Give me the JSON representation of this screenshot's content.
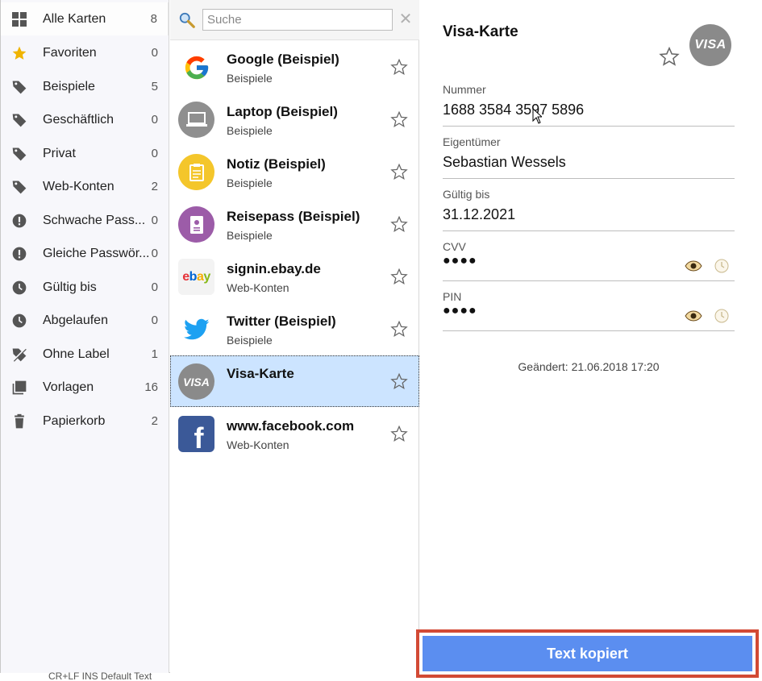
{
  "sidebar": {
    "items": [
      {
        "label": "Alle Karten",
        "count": "8",
        "icon": "grid-icon"
      },
      {
        "label": "Favoriten",
        "count": "0",
        "icon": "star-filled-icon"
      },
      {
        "label": "Beispiele",
        "count": "5",
        "icon": "tag-icon"
      },
      {
        "label": "Geschäftlich",
        "count": "0",
        "icon": "tag-icon"
      },
      {
        "label": "Privat",
        "count": "0",
        "icon": "tag-icon"
      },
      {
        "label": "Web-Konten",
        "count": "2",
        "icon": "tag-icon"
      },
      {
        "label": "Schwache Pass...",
        "count": "0",
        "icon": "warning-icon"
      },
      {
        "label": "Gleiche Passwör...",
        "count": "0",
        "icon": "warning-icon"
      },
      {
        "label": "Gültig bis",
        "count": "0",
        "icon": "clock-icon"
      },
      {
        "label": "Abgelaufen",
        "count": "0",
        "icon": "clock-icon"
      },
      {
        "label": "Ohne Label",
        "count": "1",
        "icon": "no-tag-icon"
      },
      {
        "label": "Vorlagen",
        "count": "16",
        "icon": "templates-icon"
      },
      {
        "label": "Papierkorb",
        "count": "2",
        "icon": "trash-icon"
      }
    ]
  },
  "search": {
    "placeholder": "Suche",
    "value": ""
  },
  "entries": [
    {
      "title": "Google (Beispiel)",
      "subtitle": "Beispiele",
      "icon": "google-icon"
    },
    {
      "title": "Laptop (Beispiel)",
      "subtitle": "Beispiele",
      "icon": "laptop-icon"
    },
    {
      "title": "Notiz (Beispiel)",
      "subtitle": "Beispiele",
      "icon": "note-icon"
    },
    {
      "title": "Reisepass (Beispiel)",
      "subtitle": "Beispiele",
      "icon": "passport-icon"
    },
    {
      "title": "signin.ebay.de",
      "subtitle": "Web-Konten",
      "icon": "ebay-icon",
      "logo_text": "ebay"
    },
    {
      "title": "Twitter (Beispiel)",
      "subtitle": "Beispiele",
      "icon": "twitter-icon"
    },
    {
      "title": "Visa-Karte",
      "subtitle": "",
      "icon": "visa-icon",
      "logo_text": "VISA"
    },
    {
      "title": "www.facebook.com",
      "subtitle": "Web-Konten",
      "icon": "facebook-icon",
      "logo_text": "f"
    }
  ],
  "detail": {
    "title": "Visa-Karte",
    "logo_text": "VISA",
    "fields": [
      {
        "label": "Nummer",
        "value": "1688 3584 3597 5896"
      },
      {
        "label": "Eigentümer",
        "value": "Sebastian Wessels"
      },
      {
        "label": "Gültig bis",
        "value": "31.12.2021"
      },
      {
        "label": "CVV",
        "value": "●●●●"
      },
      {
        "label": "PIN",
        "value": "●●●●"
      }
    ],
    "changed": "Geändert: 21.06.2018 17:20"
  },
  "toast": {
    "text": "Text kopiert"
  },
  "statusbar": {
    "text": "CR+LF  INS   Default Text"
  },
  "colors": {
    "accent": "#5b8ef0",
    "selection": "#cce4ff",
    "highlight_border": "#d24a35",
    "star": "#f0b400"
  }
}
